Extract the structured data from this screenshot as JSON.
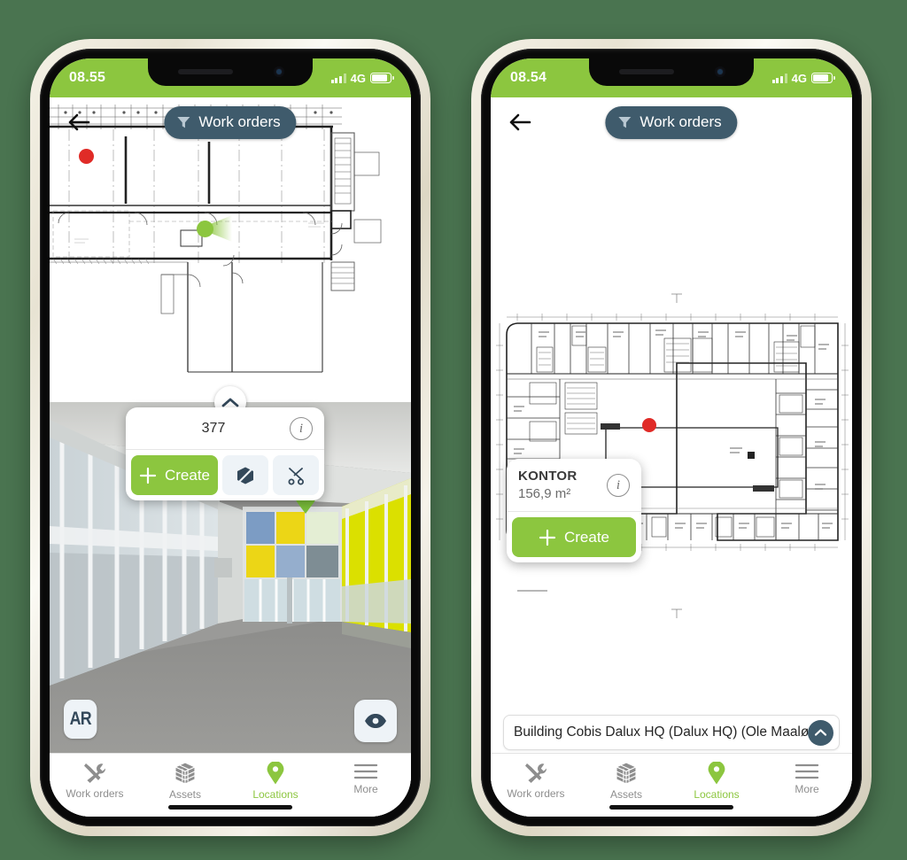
{
  "background_color": "#4a7450",
  "brand": {
    "green": "#8cc63f",
    "slate": "#3f5b6c",
    "marker_red": "#e02b27"
  },
  "phones": [
    {
      "id": "left",
      "status_bar": {
        "clock": "08.55",
        "network": "4G",
        "signal_icon": "signal-bars-icon",
        "battery_icon": "battery-icon"
      },
      "header": {
        "back_icon": "back-arrow-icon",
        "filter_pill": {
          "icon": "filter-funnel-icon",
          "label": "Work orders"
        }
      },
      "plan": {
        "markers": [
          {
            "type": "work-order-dot",
            "color": "#e02b27"
          },
          {
            "type": "user-position",
            "color": "#8cc63f"
          }
        ]
      },
      "split_handle_icon": "chevron-up-icon",
      "ar_view": {
        "ar_badge_label": "AR",
        "visibility_icon": "eye-icon"
      },
      "popup": {
        "title": "377",
        "info_icon": "info-icon",
        "create_label": "Create",
        "create_icon": "plus-icon",
        "actions": [
          {
            "icon": "hide-model-icon"
          },
          {
            "icon": "scissors-clip-icon"
          }
        ]
      },
      "tabbar": [
        {
          "label": "Work orders",
          "icon": "tools-icon",
          "active": false
        },
        {
          "label": "Assets",
          "icon": "cube-icon",
          "active": false
        },
        {
          "label": "Locations",
          "icon": "map-pin-icon",
          "active": true
        },
        {
          "label": "More",
          "icon": "hamburger-icon",
          "active": false
        }
      ]
    },
    {
      "id": "right",
      "status_bar": {
        "clock": "08.54",
        "network": "4G",
        "signal_icon": "signal-bars-icon",
        "battery_icon": "battery-icon"
      },
      "header": {
        "back_icon": "back-arrow-icon",
        "filter_pill": {
          "icon": "filter-funnel-icon",
          "label": "Work orders"
        }
      },
      "plan": {
        "markers": [
          {
            "type": "work-order-dot",
            "color": "#e02b27"
          },
          {
            "type": "selected-room",
            "color": "#8cc63f"
          }
        ]
      },
      "popup": {
        "title": "KONTOR",
        "subtitle": "156,9 m²",
        "info_icon": "info-icon",
        "create_label": "Create",
        "create_icon": "plus-icon"
      },
      "location_bar": {
        "text": "Building Cobis Dalux HQ (Dalux HQ) (Ole Maaløes",
        "expand_icon": "chevron-up-icon"
      },
      "tabbar": [
        {
          "label": "Work orders",
          "icon": "tools-icon",
          "active": false
        },
        {
          "label": "Assets",
          "icon": "cube-icon",
          "active": false
        },
        {
          "label": "Locations",
          "icon": "map-pin-icon",
          "active": true
        },
        {
          "label": "More",
          "icon": "hamburger-icon",
          "active": false
        }
      ]
    }
  ]
}
